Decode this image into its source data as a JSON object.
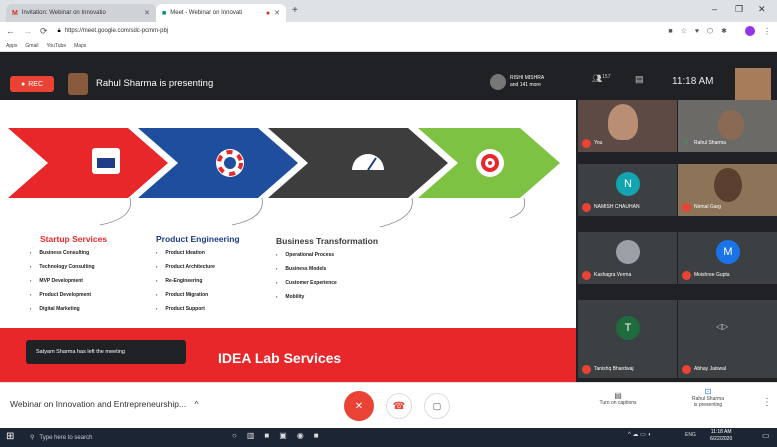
{
  "browser": {
    "tabs": [
      {
        "label": "Invitation: Webinar on Innovatio"
      },
      {
        "label": "Meet - Webinar on Innovati"
      }
    ],
    "url": "https://meet.google.com/sdc-pcmm-pbj",
    "bookmarks": [
      "Apps",
      "Gmail",
      "YouTube",
      "Maps"
    ]
  },
  "meet": {
    "rec_label": "REC",
    "presenting_text": "Rahul Sharma is presenting",
    "presenter_top": "RISHI MISHRA",
    "presenter_more": "and 141 more",
    "participant_count": "157",
    "time": "11:18 AM",
    "meeting_title": "Webinar on Innovation and Entrepreneurship...",
    "captions_label": "Turn on captions",
    "presenting_label_1": "Rahul Sharma",
    "presenting_label_2": "is presenting",
    "toast": "Satyam Sharma has left the meeting"
  },
  "participants": [
    {
      "name": "You",
      "initial": ""
    },
    {
      "name": "Rahul Sharma",
      "initial": ""
    },
    {
      "name": "NAMISH CHAUHAN",
      "initial": "N"
    },
    {
      "name": "Nirmal Garg",
      "initial": ""
    },
    {
      "name": "Kashagra Verma",
      "initial": ""
    },
    {
      "name": "Moishree Gupta",
      "initial": "M"
    },
    {
      "name": "Tanishq Bhardwaj",
      "initial": "T"
    },
    {
      "name": "Abhay Jaiswal",
      "initial": ""
    }
  ],
  "slide": {
    "footer": "IDEA Lab Services",
    "columns": [
      {
        "title": "Startup Services",
        "color": "#e8272b",
        "items": [
          "Business Consulting",
          "Technology Consulting",
          "MVP Development",
          "Product Development",
          "Digital Marketing"
        ]
      },
      {
        "title": "Product Engineering",
        "color": "#1f3c88",
        "items": [
          "Product Ideation",
          "Product Architecture",
          "Re-Engineering",
          "Product Migration",
          "Product Support"
        ]
      },
      {
        "title": "Business Transformation",
        "color": "#3a3a3a",
        "items": [
          "Operational Process",
          "Business Models",
          "Customer Experience",
          "Mobility"
        ]
      }
    ]
  },
  "taskbar": {
    "search_placeholder": "Type here to search",
    "lang": "ENG",
    "time": "11:18 AM",
    "date": "6/22/2020"
  },
  "colors": {
    "accent_red": "#e8272b",
    "blue": "#1f4e9e",
    "grey": "#3d3d3d",
    "green": "#7dc242"
  }
}
